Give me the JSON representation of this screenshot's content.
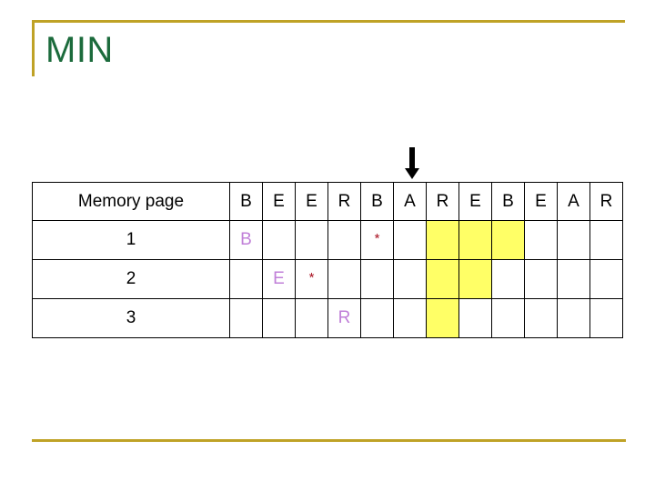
{
  "slide": {
    "title": "MIN"
  },
  "accent": {
    "border_color": "#bfa226",
    "title_color": "#1c6b3c",
    "highlight_color": "#ffff66",
    "reference_letter_color": "#c07fd8",
    "star_color": "#a81020",
    "arrow_color": "#000000"
  },
  "arrow": {
    "name": "down-arrow",
    "points_to_column_index": 6,
    "points_to_column_label": "A",
    "glyph": "↓"
  },
  "table": {
    "row_label_header": "Memory page",
    "reference_string": [
      "B",
      "E",
      "E",
      "R",
      "B",
      "A",
      "R",
      "E",
      "B",
      "E",
      "A",
      "R"
    ],
    "rows": [
      {
        "label": "1",
        "cells": [
          {
            "text": "B",
            "kind": "letter",
            "highlight": false
          },
          {
            "text": "",
            "kind": "empty",
            "highlight": false
          },
          {
            "text": "",
            "kind": "empty",
            "highlight": false
          },
          {
            "text": "",
            "kind": "empty",
            "highlight": false
          },
          {
            "text": "*",
            "kind": "star",
            "highlight": false
          },
          {
            "text": "",
            "kind": "empty",
            "highlight": false
          },
          {
            "text": "",
            "kind": "empty",
            "highlight": true
          },
          {
            "text": "",
            "kind": "empty",
            "highlight": true
          },
          {
            "text": "",
            "kind": "empty",
            "highlight": true
          },
          {
            "text": "",
            "kind": "empty",
            "highlight": false
          },
          {
            "text": "",
            "kind": "empty",
            "highlight": false
          },
          {
            "text": "",
            "kind": "empty",
            "highlight": false
          }
        ]
      },
      {
        "label": "2",
        "cells": [
          {
            "text": "",
            "kind": "empty",
            "highlight": false
          },
          {
            "text": "E",
            "kind": "letter",
            "highlight": false
          },
          {
            "text": "*",
            "kind": "star",
            "highlight": false
          },
          {
            "text": "",
            "kind": "empty",
            "highlight": false
          },
          {
            "text": "",
            "kind": "empty",
            "highlight": false
          },
          {
            "text": "",
            "kind": "empty",
            "highlight": false
          },
          {
            "text": "",
            "kind": "empty",
            "highlight": true
          },
          {
            "text": "",
            "kind": "empty",
            "highlight": true
          },
          {
            "text": "",
            "kind": "empty",
            "highlight": false
          },
          {
            "text": "",
            "kind": "empty",
            "highlight": false
          },
          {
            "text": "",
            "kind": "empty",
            "highlight": false
          },
          {
            "text": "",
            "kind": "empty",
            "highlight": false
          }
        ]
      },
      {
        "label": "3",
        "cells": [
          {
            "text": "",
            "kind": "empty",
            "highlight": false
          },
          {
            "text": "",
            "kind": "empty",
            "highlight": false
          },
          {
            "text": "",
            "kind": "empty",
            "highlight": false
          },
          {
            "text": "R",
            "kind": "letter",
            "highlight": false
          },
          {
            "text": "",
            "kind": "empty",
            "highlight": false
          },
          {
            "text": "",
            "kind": "empty",
            "highlight": false
          },
          {
            "text": "",
            "kind": "empty",
            "highlight": true
          },
          {
            "text": "",
            "kind": "empty",
            "highlight": false
          },
          {
            "text": "",
            "kind": "empty",
            "highlight": false
          },
          {
            "text": "",
            "kind": "empty",
            "highlight": false
          },
          {
            "text": "",
            "kind": "empty",
            "highlight": false
          },
          {
            "text": "",
            "kind": "empty",
            "highlight": false
          }
        ]
      }
    ]
  }
}
